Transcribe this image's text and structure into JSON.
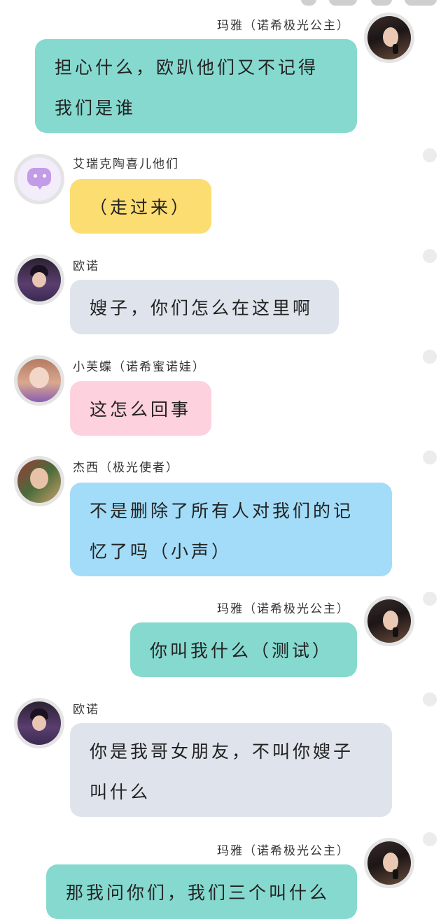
{
  "messages": [
    {
      "id": "m1",
      "side": "right",
      "sender": "玛雅（诺希极光公主）",
      "avatar": "maya-avatar",
      "color": "teal",
      "lines": [
        "担心什么，欧趴他们又不记得",
        "我们是谁"
      ]
    },
    {
      "id": "m2",
      "side": "left",
      "sender": "艾瑞克陶喜儿他们",
      "avatar": "chat-bubble-avatar",
      "color": "yellow",
      "lines": [
        "（走过来）"
      ]
    },
    {
      "id": "m3",
      "side": "left",
      "sender": "欧诺",
      "avatar": "ouno-avatar",
      "color": "gray",
      "lines": [
        "嫂子，你们怎么在这里啊"
      ]
    },
    {
      "id": "m4",
      "side": "left",
      "sender": "小芙蝶（诺希蜜诺娃）",
      "avatar": "xiaofudie-avatar",
      "color": "pink",
      "lines": [
        "这怎么回事"
      ]
    },
    {
      "id": "m5",
      "side": "left",
      "sender": "杰西（极光使者）",
      "avatar": "jiexi-avatar",
      "color": "blue",
      "lines": [
        "不是删除了所有人对我们的记",
        "忆了吗（小声）"
      ]
    },
    {
      "id": "m6",
      "side": "right",
      "sender": "玛雅（诺希极光公主）",
      "avatar": "maya-avatar",
      "color": "teal",
      "lines": [
        "你叫我什么（测试）"
      ]
    },
    {
      "id": "m7",
      "side": "left",
      "sender": "欧诺",
      "avatar": "ouno-avatar",
      "color": "gray",
      "lines": [
        "你是我哥女朋友，不叫你嫂子",
        "叫什么"
      ]
    },
    {
      "id": "m8",
      "side": "right",
      "sender": "玛雅（诺希极光公主）",
      "avatar": "maya-avatar",
      "color": "teal",
      "lines": [
        "那我问你们，我们三个叫什么"
      ]
    }
  ],
  "colors": {
    "teal": "#86d9cf",
    "yellow": "#fcdd72",
    "gray": "#dfe4ec",
    "pink": "#fdd1dd",
    "blue": "#a2dcf8"
  }
}
